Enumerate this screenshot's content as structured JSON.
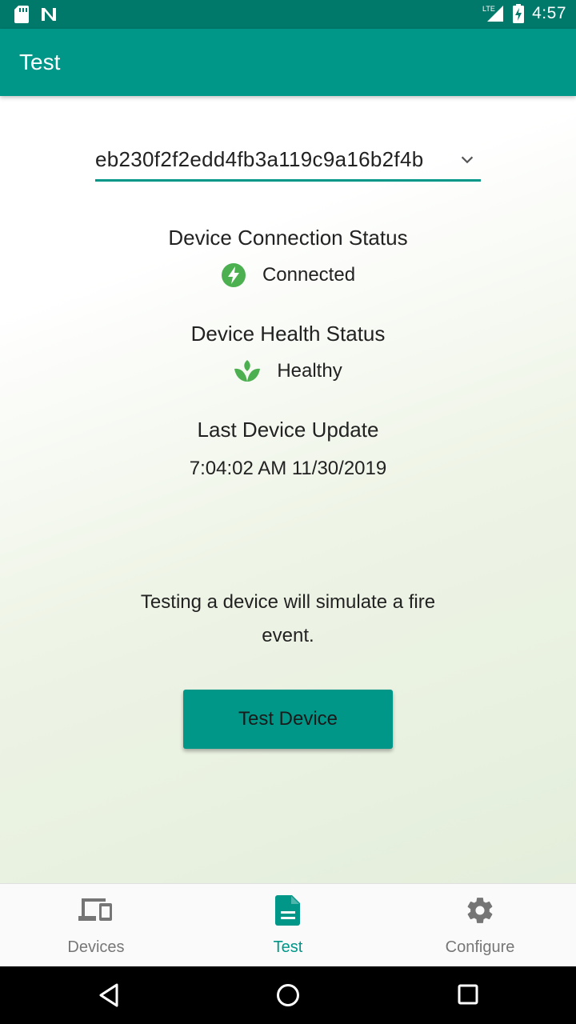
{
  "status_bar": {
    "time": "4:57",
    "network": "LTE"
  },
  "app_bar": {
    "title": "Test"
  },
  "device_select": {
    "selected": "eb230f2f2edd4fb3a119c9a16b2f4b"
  },
  "connection": {
    "heading": "Device Connection Status",
    "value": "Connected"
  },
  "health": {
    "heading": "Device Health Status",
    "value": "Healthy"
  },
  "last_update": {
    "heading": "Last Device Update",
    "value": "7:04:02 AM 11/30/2019"
  },
  "hint": {
    "text": "Testing a device will simulate a fire event."
  },
  "test_button": {
    "label": "Test Device"
  },
  "bottom_nav": {
    "items": [
      {
        "label": "Devices",
        "icon": "devices-icon"
      },
      {
        "label": "Test",
        "icon": "document-icon"
      },
      {
        "label": "Configure",
        "icon": "gear-icon"
      }
    ],
    "active_index": 1
  },
  "colors": {
    "primary": "#009688",
    "primary_dark": "#00796b",
    "status_green": "#4caf50",
    "inactive": "#777777"
  }
}
